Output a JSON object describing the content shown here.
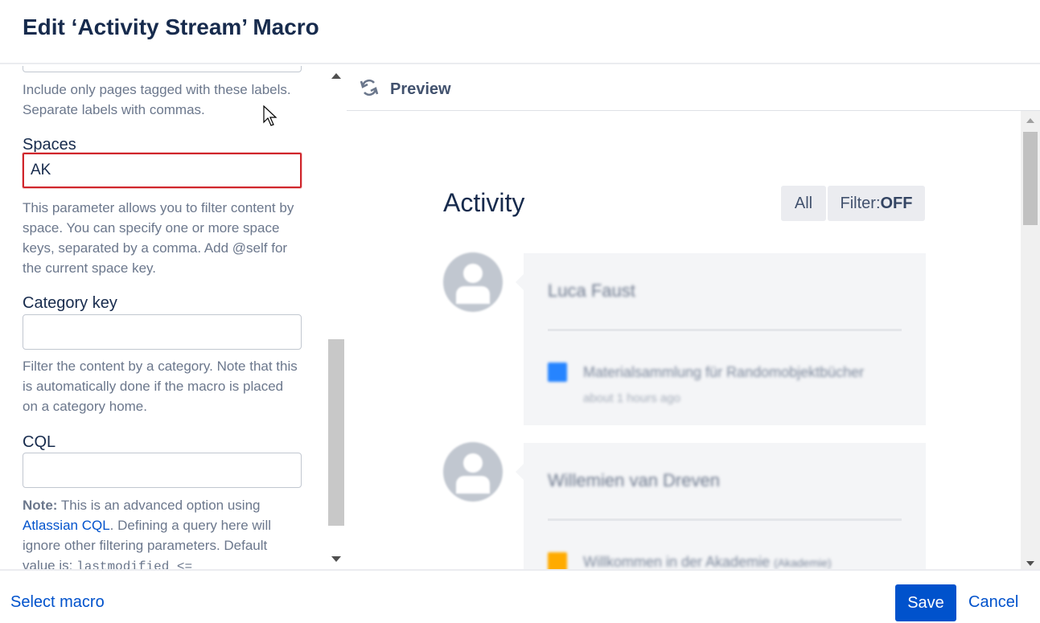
{
  "dialog": {
    "title": "Edit ‘Activity Stream’ Macro"
  },
  "form": {
    "labels_help": "Include only pages tagged with these labels. Separate labels with commas.",
    "spaces": {
      "label": "Spaces",
      "value": "AK",
      "help": "This parameter allows you to filter content by space. You can specify one or more space keys, separated by a comma. Add @self for the current space key."
    },
    "category_key": {
      "label": "Category key",
      "value": "",
      "help": "Filter the content by a category. Note that this is automatically done if the macro is placed on a category home."
    },
    "cql": {
      "label": "CQL",
      "value": "",
      "note_bold": "Note:",
      "note_text_1": " This is an advanced option using ",
      "note_link": "Atlassian CQL",
      "note_text_2": ". Defining a query here will ignore other filtering parameters. Default value is: ",
      "note_code": "lastmodified <="
    }
  },
  "preview": {
    "title": "Preview",
    "activity_title": "Activity",
    "btn_all": "All",
    "btn_filter_prefix": "Filter:",
    "btn_filter_state": "OFF",
    "entries": [
      {
        "name": "Luca Faust",
        "link": "Materialsammlung für Randomobjektbücher",
        "time": "about 1 hours ago",
        "icon_color": "#2684ff"
      },
      {
        "name": "Willemien van Dreven",
        "link": "Willkommen in der Akademie",
        "link_suffix": "(Akademie)",
        "icon_color": "#ffab00"
      }
    ]
  },
  "footer": {
    "select_macro": "Select macro",
    "save": "Save",
    "cancel": "Cancel"
  },
  "colors": {
    "primary": "#0052cc",
    "highlight_border": "#d0262c"
  }
}
